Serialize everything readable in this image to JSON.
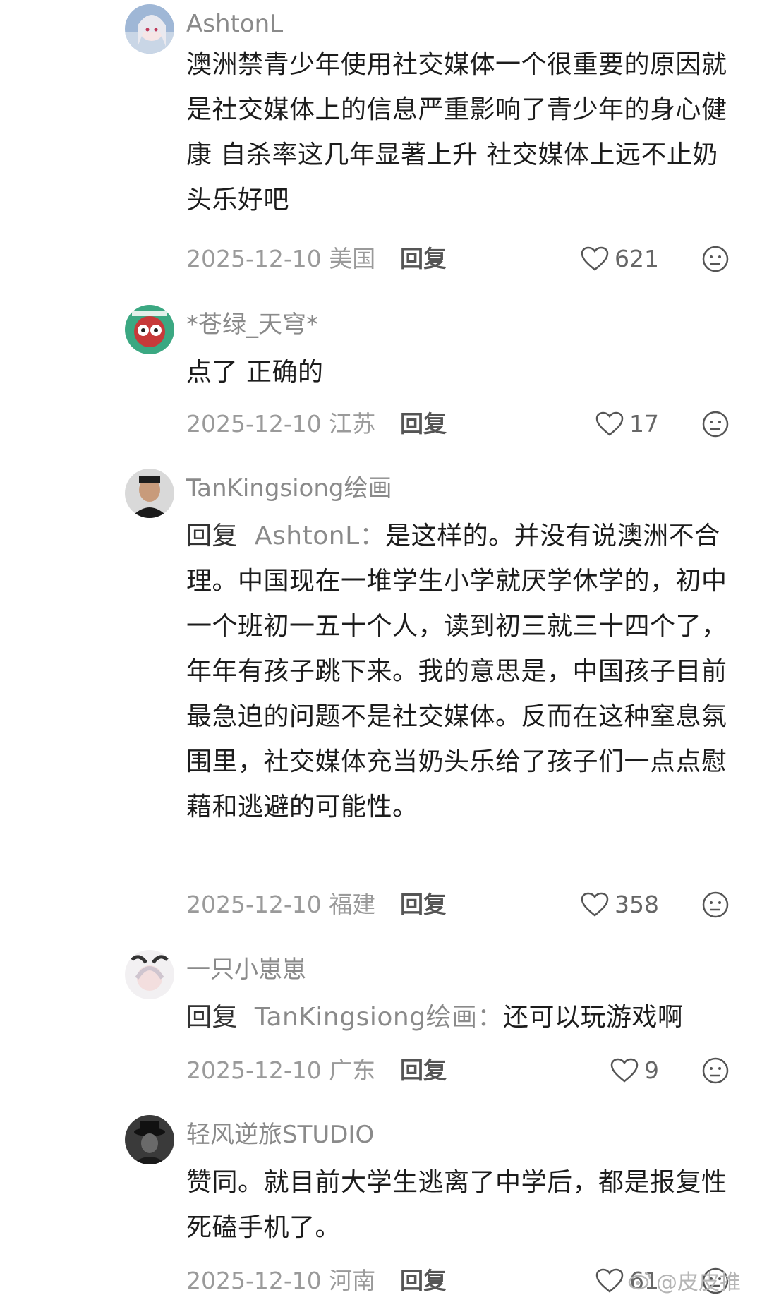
{
  "comments": [
    {
      "username": "AshtonL",
      "reply_prefix": "",
      "reply_to": "",
      "text": "澳洲禁青少年使用社交媒体一个很重要的原因就是社交媒体上的信息严重影响了青少年的身心健康 自杀率这几年显著上升 社交媒体上远不止奶头乐好吧",
      "date": "2025-12-10 美国",
      "reply_label": "回复",
      "likes": "621"
    },
    {
      "username": "*苍绿_天穹*",
      "reply_prefix": "",
      "reply_to": "",
      "text": "点了 正确的",
      "date": "2025-12-10 江苏",
      "reply_label": "回复",
      "likes": "17"
    },
    {
      "username": "TanKingsiong绘画",
      "reply_prefix": "回复",
      "reply_to": "AshtonL：",
      "text": "是这样的。并没有说澳洲不合理。中国现在一堆学生小学就厌学休学的，初中一个班初一五十个人，读到初三就三十四个了，年年有孩子跳下来。我的意思是，中国孩子目前最急迫的问题不是社交媒体。反而在这种窒息氛围里，社交媒体充当奶头乐给了孩子们一点点慰藉和逃避的可能性。",
      "date": "2025-12-10 福建",
      "reply_label": "回复",
      "likes": "358"
    },
    {
      "username": "一只小崽崽",
      "reply_prefix": "回复",
      "reply_to": "TanKingsiong绘画：",
      "text": "还可以玩游戏啊",
      "date": "2025-12-10 广东",
      "reply_label": "回复",
      "likes": "9"
    },
    {
      "username": "轻风逆旅STUDIO",
      "reply_prefix": "",
      "reply_to": "",
      "text": "赞同。就目前大学生逃离了中学后，都是报复性死磕手机了。",
      "date": "2025-12-10 河南",
      "reply_label": "回复",
      "likes": "61"
    }
  ],
  "watermark": "@皮皮推",
  "icons": {
    "like": "heart-outline-icon",
    "dislike": "neutral-face-icon"
  },
  "colors": {
    "text": "#1c1c1c",
    "secondary": "#8a8a8a"
  }
}
